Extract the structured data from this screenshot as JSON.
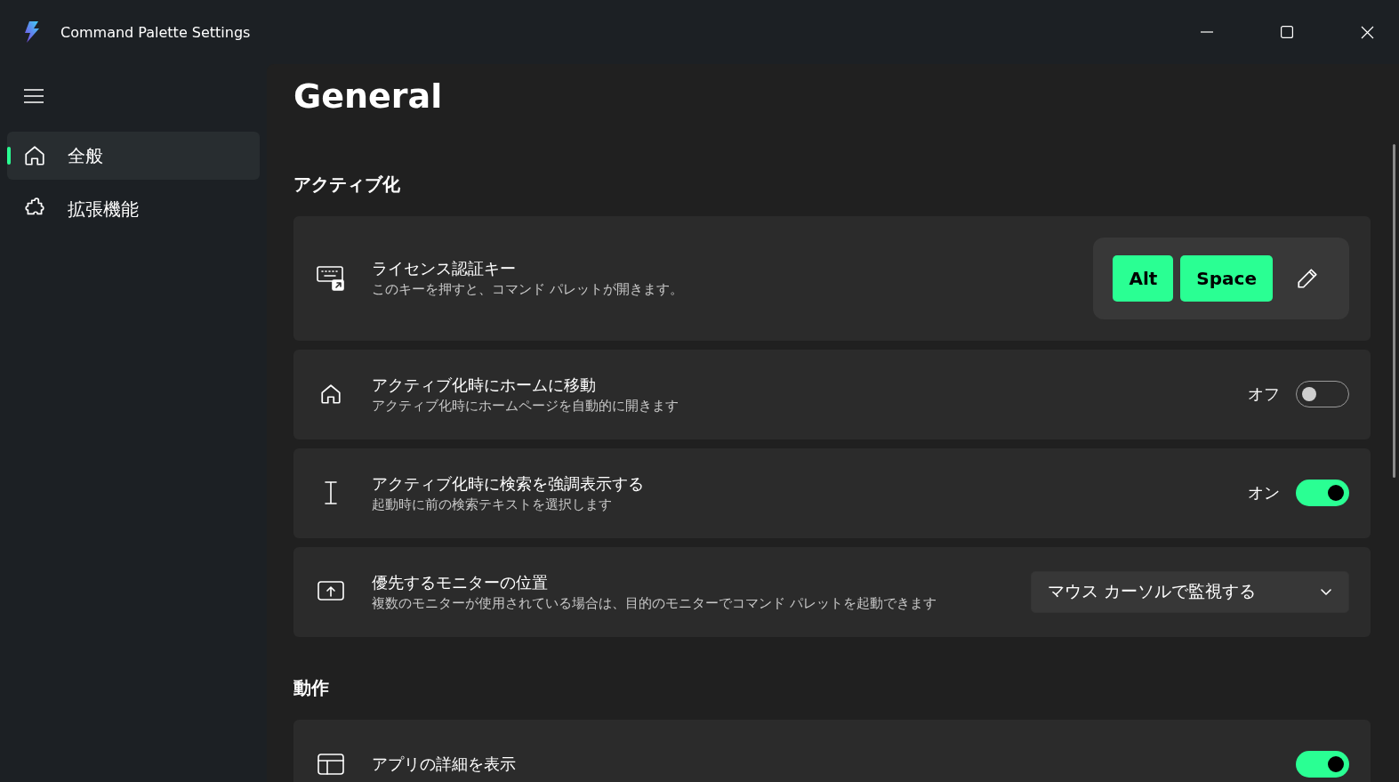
{
  "window": {
    "title": "Command Palette Settings"
  },
  "sidebar": {
    "items": [
      {
        "label": "全般",
        "selected": true
      },
      {
        "label": "拡張機能",
        "selected": false
      }
    ]
  },
  "page": {
    "title": "General"
  },
  "sections": [
    {
      "title": "アクティブ化",
      "rows": [
        {
          "kind": "hotkey",
          "title": "ライセンス認証キー",
          "description": "このキーを押すと、コマンド パレットが開きます。",
          "keys": [
            "Alt",
            "Space"
          ]
        },
        {
          "kind": "toggle",
          "title": "アクティブ化時にホームに移動",
          "description": "アクティブ化時にホームページを自動的に開きます",
          "state_label": "オフ",
          "on": false
        },
        {
          "kind": "toggle",
          "title": "アクティブ化時に検索を強調表示する",
          "description": "起動時に前の検索テキストを選択します",
          "state_label": "オン",
          "on": true
        },
        {
          "kind": "dropdown",
          "title": "優先するモニターの位置",
          "description": "複数のモニターが使用されている場合は、目的のモニターでコマンド パレットを起動できます",
          "value": "マウス カーソルで監視する"
        }
      ]
    },
    {
      "title": "動作",
      "rows": [
        {
          "kind": "toggle",
          "title": "アプリの詳細を表示",
          "on": true
        }
      ]
    }
  ]
}
